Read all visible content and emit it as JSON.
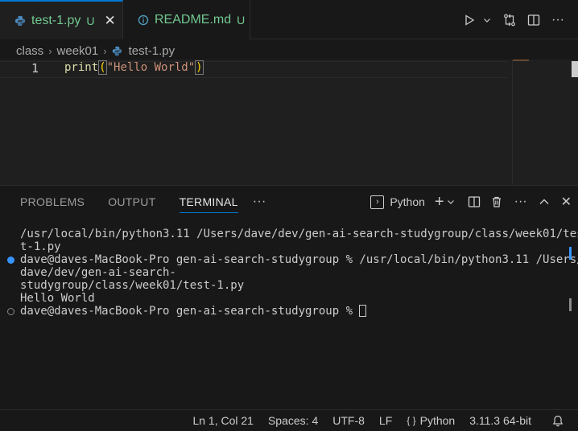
{
  "tabs": [
    {
      "label": "test-1.py",
      "status": "U",
      "close": "✕",
      "icon": "python-icon",
      "active": true
    },
    {
      "label": "README.md",
      "status": "U",
      "icon": "info-icon",
      "active": false
    }
  ],
  "toolbar": {
    "run": "▷",
    "run_menu": "⌄",
    "compare": "⇄",
    "split": "◫",
    "more": "···"
  },
  "breadcrumb": {
    "items": [
      "class",
      "week01",
      "test-1.py"
    ],
    "separator": "›"
  },
  "editor": {
    "line_number": "1",
    "code_fn": "print",
    "code_open": "(",
    "code_string": "\"Hello World\"",
    "code_close": ")"
  },
  "panel": {
    "tabs": [
      "PROBLEMS",
      "OUTPUT",
      "TERMINAL"
    ],
    "more": "···",
    "active_tab": "TERMINAL",
    "terminal_label": "Python",
    "actions": {
      "add": "+",
      "add_menu": "⌄",
      "split": "◫",
      "trash": "🗑",
      "more": "···",
      "maximize": "⌃",
      "close": "✕"
    }
  },
  "terminal": {
    "lines": [
      "/usr/local/bin/python3.11 /Users/dave/dev/gen-ai-search-studygroup/class/week01/tes",
      "t-1.py",
      "dave@daves-MacBook-Pro gen-ai-search-studygroup % /usr/local/bin/python3.11 /Users/",
      "dave/dev/gen-ai-search-",
      "studygroup/class/week01/test-1.py",
      "Hello World",
      "dave@daves-MacBook-Pro gen-ai-search-studygroup % "
    ]
  },
  "statusbar": {
    "position": "Ln 1, Col 21",
    "spaces": "Spaces: 4",
    "encoding": "UTF-8",
    "eol": "LF",
    "language": "Python",
    "language_icon": "{ }",
    "interpreter": "3.11.3 64-bit",
    "bell": "🔔"
  },
  "colors": {
    "accent": "#0078d4",
    "untracked": "#73c991",
    "string": "#ce9178",
    "function": "#dcdcaa",
    "bracket": "#ffd700"
  }
}
